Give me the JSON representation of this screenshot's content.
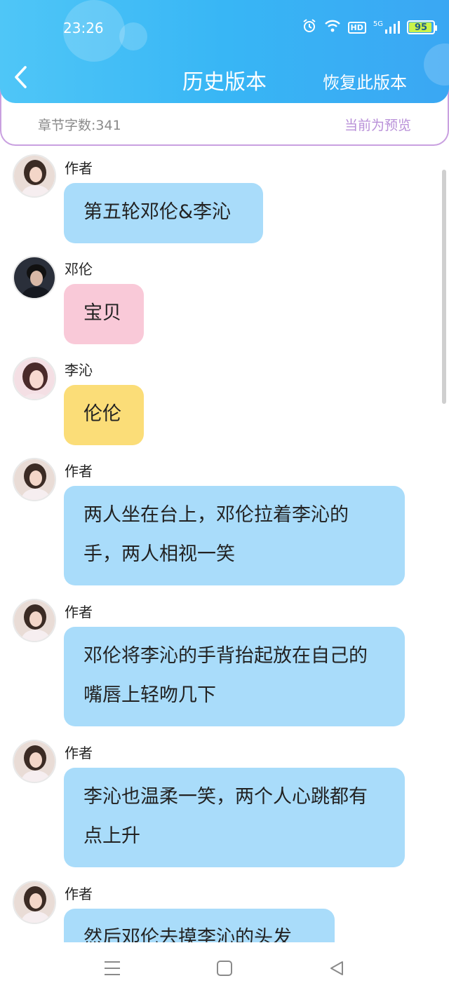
{
  "status_bar": {
    "time": "23:26",
    "hd_label": "HD",
    "net_label": "5G",
    "battery": "95"
  },
  "header": {
    "title": "历史版本",
    "restore_label": "恢复此版本"
  },
  "subheader": {
    "word_count": "章节字数:341",
    "preview_label": "当前为预览"
  },
  "colors": {
    "header_accent": "#3aaef5",
    "bubble_author": "#a9dcfa",
    "bubble_denglun": "#f9c9d8",
    "bubble_liqin": "#fbdd78",
    "panel_border": "#c9a0e0"
  },
  "messages": [
    {
      "sender": "作者",
      "text": "第五轮邓伦&李沁"
    },
    {
      "sender": "邓伦",
      "text": "宝贝"
    },
    {
      "sender": "李沁",
      "text": "伦伦"
    },
    {
      "sender": "作者",
      "text": "两人坐在台上，邓伦拉着李沁的手，两人相视一笑"
    },
    {
      "sender": "作者",
      "text": "邓伦将李沁的手背抬起放在自己的嘴唇上轻吻几下"
    },
    {
      "sender": "作者",
      "text": "李沁也温柔一笑，两个人心跳都有点上升"
    },
    {
      "sender": "作者",
      "text": "然后邓伦去摸李沁的头发"
    }
  ],
  "nav": {
    "menu_icon": "menu-icon",
    "home_icon": "square-home-icon",
    "back_icon": "triangle-back-icon"
  }
}
